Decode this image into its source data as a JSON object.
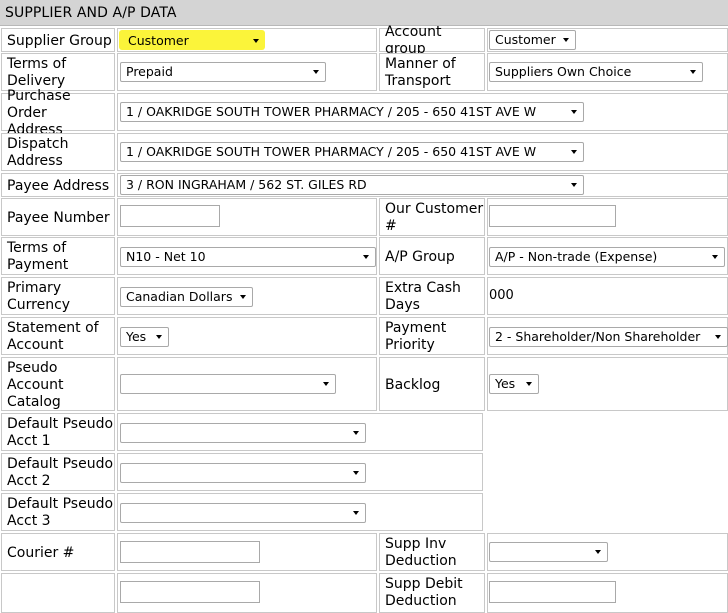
{
  "header": {
    "title": "SUPPLIER AND A/P DATA"
  },
  "fields": {
    "supplier_group": {
      "label": "Supplier Group",
      "value": "Customer",
      "highlight_color": "#fbf43a"
    },
    "account_group": {
      "label": "Account group",
      "value": "Customer"
    },
    "terms_of_delivery": {
      "label_line1": "Terms of",
      "label_line2": "Delivery",
      "value": "Prepaid"
    },
    "manner_of_transport": {
      "label_line1": "Manner of",
      "label_line2": "Transport",
      "value": "Suppliers Own Choice"
    },
    "purchase_order_address": {
      "label_line1": "Purchase Order",
      "label_line2": "Address",
      "value": "1 / OAKRIDGE SOUTH TOWER PHARMACY / 205 - 650 41ST AVE W"
    },
    "dispatch_address": {
      "label_line1": "Dispatch",
      "label_line2": "Address",
      "value": "1 / OAKRIDGE SOUTH TOWER PHARMACY / 205 - 650 41ST AVE W"
    },
    "payee_address": {
      "label": "Payee Address",
      "value": "3 / RON INGRAHAM / 562 ST. GILES RD"
    },
    "payee_number": {
      "label": "Payee Number",
      "value": ""
    },
    "our_customer_no": {
      "label_line1": "Our Customer",
      "label_line2": "#",
      "value": ""
    },
    "terms_of_payment": {
      "label_line1": "Terms of",
      "label_line2": "Payment",
      "value": "N10 - Net 10"
    },
    "ap_group": {
      "label": "A/P Group",
      "value": "A/P - Non-trade (Expense)"
    },
    "primary_currency": {
      "label_line1": "Primary",
      "label_line2": "Currency",
      "value": "Canadian Dollars"
    },
    "extra_cash_days": {
      "label_line1": "Extra Cash",
      "label_line2": "Days",
      "value": "000"
    },
    "statement_of_account": {
      "label_line1": "Statement of",
      "label_line2": "Account",
      "value": "Yes"
    },
    "payment_priority": {
      "label_line1": "Payment",
      "label_line2": "Priority",
      "value": "2 - Shareholder/Non Shareholder"
    },
    "pseudo_account_catalog": {
      "label_line1": "Pseudo",
      "label_line2": "Account",
      "label_line3": "Catalog",
      "value": ""
    },
    "backlog": {
      "label": "Backlog",
      "value": "Yes"
    },
    "default_pseudo_acct_1": {
      "label_line1": "Default Pseudo",
      "label_line2": "Acct 1",
      "value": ""
    },
    "default_pseudo_acct_2": {
      "label_line1": "Default Pseudo",
      "label_line2": "Acct 2",
      "value": ""
    },
    "default_pseudo_acct_3": {
      "label_line1": "Default Pseudo",
      "label_line2": "Acct 3",
      "value": ""
    },
    "courier_no": {
      "label": "Courier #",
      "value": ""
    },
    "supp_inv_deduction": {
      "label_line1": "Supp Inv",
      "label_line2": "Deduction",
      "value": ""
    },
    "supp_debit_deduction": {
      "label_line1": "Supp Debit",
      "label_line2": "Deduction",
      "value": ""
    }
  }
}
